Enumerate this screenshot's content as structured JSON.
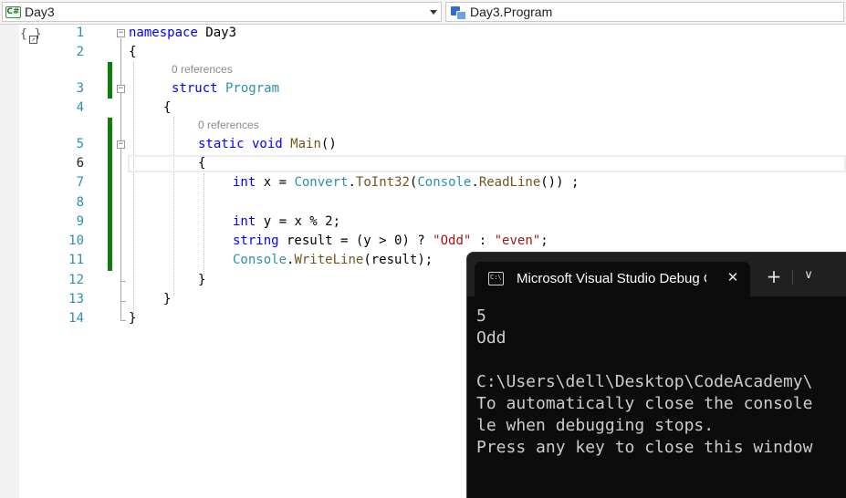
{
  "navbar": {
    "project_icon": "C#",
    "project": "Day3",
    "member": "Day3.Program"
  },
  "editor": {
    "line_numbers": [
      "1",
      "2",
      "3",
      "4",
      "5",
      "6",
      "7",
      "8",
      "9",
      "10",
      "11",
      "12",
      "13",
      "14"
    ],
    "references_struct": "0 references",
    "references_main": "0 references",
    "code": {
      "l1_kw": "namespace",
      "l1_name": " Day3",
      "l2": "{",
      "l3_kw": "struct",
      "l3_name": " Program",
      "l4": "{",
      "l5_kw1": "static",
      "l5_kw2": " void",
      "l5_name": " Main",
      "l5_parens": "()",
      "l6": "{",
      "l7_kw": "int",
      "l7_a": " x = ",
      "l7_t1": "Convert",
      "l7_b": ".",
      "l7_m1": "ToInt32",
      "l7_c": "(",
      "l7_t2": "Console",
      "l7_d": ".",
      "l7_m2": "ReadLine",
      "l7_e": "()) ;",
      "l9_kw": "int",
      "l9_rest": " y = x % 2;",
      "l10_kw": "string",
      "l10_a": " result = (y > 0) ? ",
      "l10_s1": "\"Odd\"",
      "l10_b": " : ",
      "l10_s2": "\"even\"",
      "l10_c": ";",
      "l11_t": "Console",
      "l11_a": ".",
      "l11_m": "WriteLine",
      "l11_b": "(result);",
      "l12": "}",
      "l13": "}",
      "l14": "}"
    }
  },
  "terminal": {
    "tab_title": "Microsoft Visual Studio Debug Console",
    "icons": {
      "tab": "cmd-icon",
      "close": "close-icon",
      "new": "plus-icon",
      "menu": "chevron-down-icon"
    },
    "lines": [
      "5",
      "Odd",
      "",
      "C:\\Users\\dell\\Desktop\\CodeAcademy\\",
      "To automatically close the console",
      "le when debugging stops.",
      "Press any key to close this window"
    ]
  }
}
